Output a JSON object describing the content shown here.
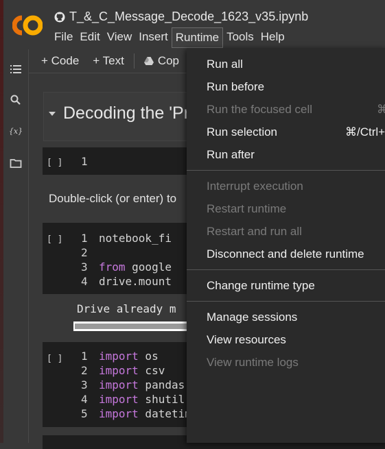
{
  "header": {
    "file_name": "T_&_C_Message_Decode_1623_v35.ipynb",
    "menus": [
      "File",
      "Edit",
      "View",
      "Insert",
      "Runtime",
      "Tools",
      "Help"
    ]
  },
  "toolbar": {
    "code_label": "+ Code",
    "text_label": "+ Text",
    "copy_label": "Cop"
  },
  "notebook": {
    "heading": "Decoding the 'Pro",
    "cell1": {
      "run": "[ ]",
      "line": "1"
    },
    "text_cell": "Double-click (or enter) to",
    "cell2": {
      "run": "[ ]",
      "lines": [
        {
          "n": "1",
          "text": "notebook_fi"
        },
        {
          "n": "2",
          "text": ""
        },
        {
          "n": "3",
          "kw": "from",
          "rest": " google"
        },
        {
          "n": "4",
          "text": "drive.mount"
        }
      ],
      "output": "Drive already m",
      "progress": 0.98
    },
    "cell3": {
      "run": "[ ]",
      "lines": [
        {
          "n": "1",
          "kw": "import",
          "rest": " os"
        },
        {
          "n": "2",
          "kw": "import",
          "rest": " csv"
        },
        {
          "n": "3",
          "kw": "import",
          "rest": " pandas ",
          "kw2": "as",
          "rest2": " pd"
        },
        {
          "n": "4",
          "kw": "import",
          "rest": " shutil"
        },
        {
          "n": "5",
          "kw": "import",
          "rest": " datetime"
        }
      ]
    }
  },
  "runtime_menu": {
    "items": [
      {
        "label": "Run all",
        "enabled": true
      },
      {
        "label": "Run before",
        "enabled": true
      },
      {
        "label": "Run the focused cell",
        "enabled": false,
        "shortcut": "⌘"
      },
      {
        "label": "Run selection",
        "enabled": true,
        "shortcut": "⌘/Ctrl+"
      },
      {
        "label": "Run after",
        "enabled": true,
        "shortcut": "⌘"
      },
      {
        "label": "Interrupt execution",
        "enabled": false
      },
      {
        "label": "Restart runtime",
        "enabled": false
      },
      {
        "label": "Restart and run all",
        "enabled": false
      },
      {
        "label": "Disconnect and delete runtime",
        "enabled": true
      },
      {
        "label": "Change runtime type",
        "enabled": true
      },
      {
        "label": "Manage sessions",
        "enabled": true
      },
      {
        "label": "View resources",
        "enabled": true
      },
      {
        "label": "View runtime logs",
        "enabled": false
      }
    ]
  },
  "colors": {
    "logo_orange": "#f9ab00",
    "logo_dark_orange": "#e8710a",
    "keyword": "#c678dd"
  }
}
